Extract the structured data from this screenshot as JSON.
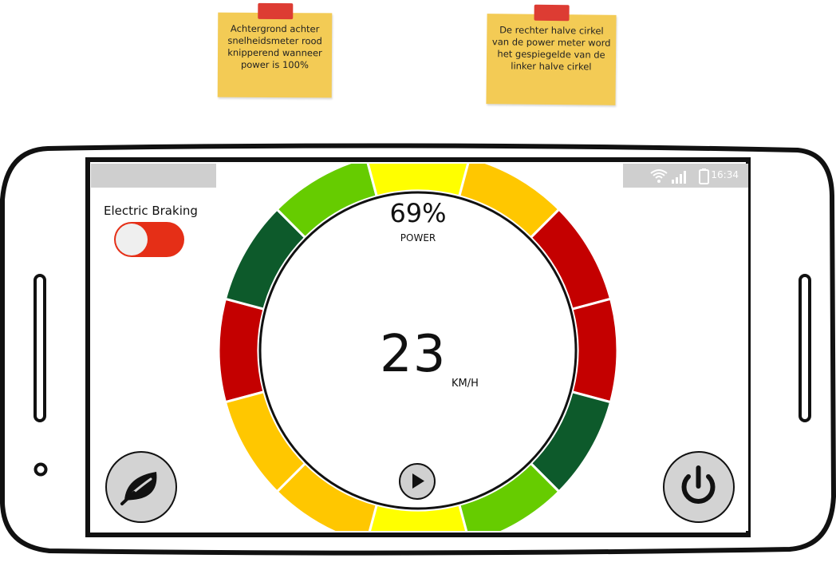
{
  "notes": [
    {
      "text": "Achtergrond achter snelheidsmeter rood knipperend wanneer power is 100%"
    },
    {
      "text": "De rechter halve cirkel van de power meter word het gespiegelde van de linker halve cirkel"
    }
  ],
  "statusbar": {
    "time": "16:34",
    "icons": [
      "wifi-icon",
      "signal-icon",
      "battery-icon"
    ]
  },
  "electric_braking": {
    "label": "Electric Braking",
    "state": "on"
  },
  "power": {
    "value": "69%",
    "label": "POWER",
    "fraction": 0.69
  },
  "speed": {
    "value": "23",
    "unit": "KM/H"
  },
  "buttons": {
    "eco": "leaf-icon",
    "power": "power-icon",
    "play": "play-icon"
  },
  "colors": {
    "dark_green": "#0d5a2b",
    "green": "#66cc00",
    "yellow": "#ffff00",
    "orange": "#ffc700",
    "red": "#c40000",
    "toggle_on": "#e52f17"
  }
}
